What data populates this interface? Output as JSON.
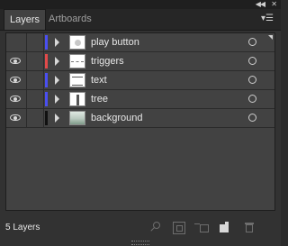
{
  "topbar": {
    "collapse_icon": "double-left-arrow",
    "close_icon": "x"
  },
  "tabs": [
    {
      "label": "Layers",
      "active": true
    },
    {
      "label": "Artboards",
      "active": false
    }
  ],
  "layers": [
    {
      "name": "play button",
      "visible": false,
      "color": "#4a4ff0",
      "thumbnail": "circle"
    },
    {
      "name": "triggers",
      "visible": true,
      "color": "#e14a4a",
      "thumbnail": "dashed-line"
    },
    {
      "name": "text",
      "visible": true,
      "color": "#4a4ff0",
      "thumbnail": "lines"
    },
    {
      "name": "tree",
      "visible": true,
      "color": "#4a4ff0",
      "thumbnail": "trunk"
    },
    {
      "name": "background",
      "visible": true,
      "color": "#111111",
      "thumbnail": "gradient"
    }
  ],
  "footer": {
    "count_label": "5 Layers",
    "icons": [
      "search-icon",
      "clipping-mask-icon",
      "create-sublayer-icon",
      "new-layer-icon",
      "trash-icon"
    ]
  }
}
